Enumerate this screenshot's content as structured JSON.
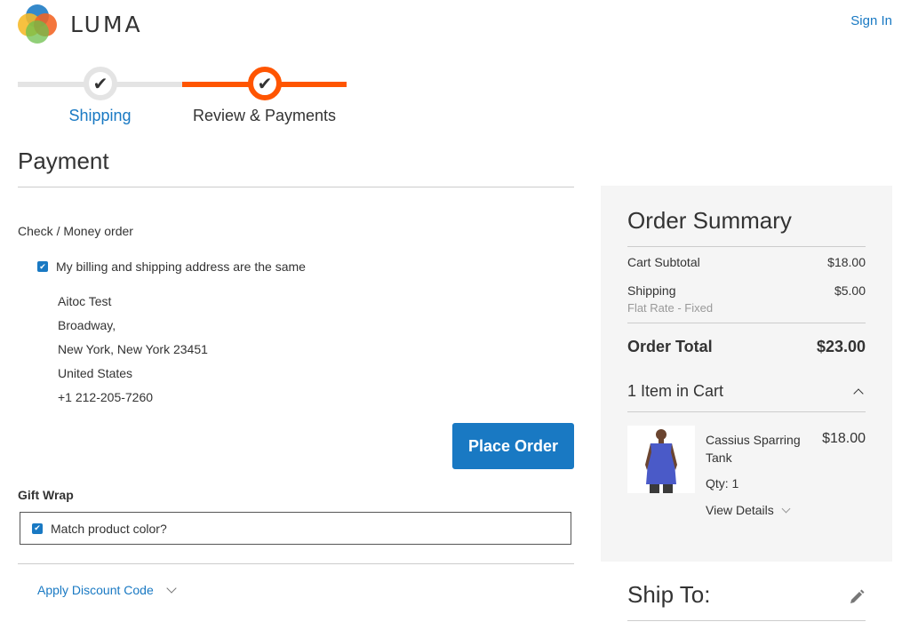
{
  "header": {
    "logo_text": "LUMA",
    "sign_in": "Sign In"
  },
  "progress": {
    "steps": [
      {
        "label": "Shipping",
        "state": "complete"
      },
      {
        "label": "Review & Payments",
        "state": "active"
      }
    ],
    "check_glyph": "✔"
  },
  "payment": {
    "title": "Payment",
    "method": "Check / Money order",
    "same_address_label": "My billing and shipping address are the same",
    "same_address_checked": true,
    "address": {
      "name": "Aitoc Test",
      "street": "Broadway,",
      "city_line": "New York, New York 23451",
      "country": "United States",
      "phone": "+1 212-205-7260"
    },
    "place_order": "Place Order",
    "gift_wrap_title": "Gift Wrap",
    "gift_wrap_option": "Match product color?",
    "gift_wrap_checked": true,
    "discount_label": "Apply Discount Code"
  },
  "summary": {
    "title": "Order Summary",
    "subtotal_label": "Cart Subtotal",
    "subtotal_value": "$18.00",
    "shipping_label": "Shipping",
    "shipping_value": "$5.00",
    "shipping_method": "Flat Rate - Fixed",
    "total_label": "Order Total",
    "total_value": "$23.00",
    "items_in_cart": "1 Item in Cart",
    "item": {
      "name": "Cassius Sparring Tank",
      "price": "$18.00",
      "qty": "Qty: 1",
      "view_details": "View Details"
    }
  },
  "ship_to": {
    "title": "Ship To:"
  },
  "colors": {
    "accent": "#1979c3",
    "progress_active": "#ff5501",
    "progress_inactive": "#e4e4e4",
    "sidebar_bg": "#f5f5f5"
  },
  "icons": [
    "checkmark-icon",
    "checkbox-icon",
    "chevron-down-icon",
    "chevron-up-icon",
    "pencil-icon"
  ]
}
